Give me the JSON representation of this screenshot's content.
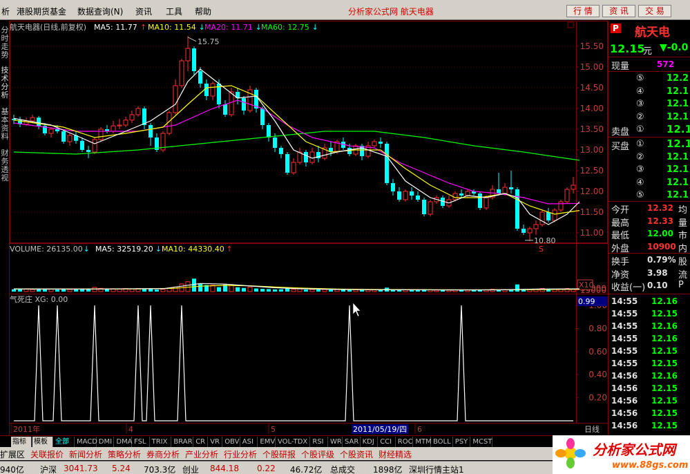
{
  "menu": {
    "items": [
      "析",
      "港股期货基金",
      "数据查询(N)",
      "资讯",
      "工具",
      "帮助"
    ],
    "site": "分析家公式网",
    "stock": "航天电器",
    "buttons": [
      "行 情",
      "资 讯",
      "交 易"
    ]
  },
  "left_tabs": [
    {
      "label": "分时走势"
    },
    {
      "label": "技术分析"
    },
    {
      "label": "基本资料"
    },
    {
      "label": "财务透视"
    }
  ],
  "kline": {
    "header": {
      "title": "航天电器(日线,前复权)",
      "ma5": "MA5: 11.77",
      "ma10": "MA10: 11.54",
      "ma20": "MA20: 11.71",
      "ma60": "MA60: 12.75"
    },
    "ylabels": [
      "15.50",
      "15.00",
      "14.50",
      "14.00",
      "13.50",
      "13.00",
      "12.50",
      "12.00",
      "11.50",
      "11.00"
    ],
    "ylim": [
      10.75,
      15.75
    ],
    "high_label": "15.75",
    "low_label": "10.80",
    "mark_s": "S",
    "candles": [
      [
        13.75,
        13.72,
        13.85,
        13.62
      ],
      [
        13.72,
        13.62,
        13.8,
        13.55
      ],
      [
        13.62,
        13.7,
        13.78,
        13.58
      ],
      [
        13.7,
        13.78,
        13.85,
        13.65
      ],
      [
        13.78,
        13.58,
        13.82,
        13.5
      ],
      [
        13.58,
        13.4,
        13.65,
        13.35
      ],
      [
        13.4,
        13.5,
        13.55,
        13.3
      ],
      [
        13.5,
        13.45,
        13.6,
        13.4
      ],
      [
        13.45,
        13.2,
        13.5,
        13.15
      ],
      [
        13.2,
        13.35,
        13.42,
        13.1
      ],
      [
        13.35,
        13.22,
        13.45,
        13.15
      ],
      [
        13.22,
        13.0,
        13.3,
        12.95
      ],
      [
        13.0,
        12.95,
        13.1,
        12.8
      ],
      [
        12.95,
        13.25,
        13.3,
        12.9
      ],
      [
        13.25,
        13.5,
        13.55,
        13.2
      ],
      [
        13.5,
        13.45,
        13.6,
        13.4
      ],
      [
        13.45,
        13.58,
        13.7,
        13.4
      ],
      [
        13.58,
        13.6,
        13.75,
        13.5
      ],
      [
        13.6,
        13.72,
        13.8,
        13.55
      ],
      [
        13.72,
        13.85,
        13.95,
        13.65
      ],
      [
        13.85,
        14.0,
        14.05,
        13.8
      ],
      [
        14.0,
        13.6,
        14.05,
        13.5
      ],
      [
        13.6,
        13.3,
        13.65,
        13.1
      ],
      [
        13.3,
        13.0,
        13.4,
        12.95
      ],
      [
        13.0,
        13.4,
        13.45,
        12.95
      ],
      [
        13.4,
        13.9,
        13.95,
        13.35
      ],
      [
        13.9,
        14.55,
        14.7,
        13.85
      ],
      [
        14.55,
        15.15,
        15.2,
        14.5
      ],
      [
        15.15,
        15.45,
        15.75,
        14.9
      ],
      [
        15.45,
        14.9,
        15.5,
        14.8
      ],
      [
        14.9,
        14.6,
        15.0,
        14.5
      ],
      [
        14.6,
        14.3,
        14.7,
        14.2
      ],
      [
        14.3,
        14.6,
        14.65,
        14.2
      ],
      [
        14.6,
        14.1,
        14.7,
        14.0
      ],
      [
        14.1,
        13.85,
        14.2,
        13.8
      ],
      [
        13.85,
        14.4,
        14.5,
        13.8
      ],
      [
        14.4,
        14.25,
        14.5,
        14.1
      ],
      [
        14.25,
        13.95,
        14.3,
        13.85
      ],
      [
        13.95,
        14.45,
        14.55,
        13.9
      ],
      [
        14.45,
        14.0,
        14.5,
        13.9
      ],
      [
        14.0,
        13.6,
        14.05,
        13.5
      ],
      [
        13.6,
        13.3,
        13.65,
        13.2
      ],
      [
        13.3,
        13.05,
        13.4,
        12.95
      ],
      [
        13.05,
        12.9,
        13.1,
        12.8
      ],
      [
        12.9,
        12.45,
        12.95,
        12.4
      ],
      [
        12.45,
        12.7,
        12.8,
        12.4
      ],
      [
        12.7,
        12.95,
        13.05,
        12.65
      ],
      [
        12.95,
        12.7,
        13.0,
        12.6
      ],
      [
        12.7,
        12.95,
        13.05,
        12.65
      ],
      [
        12.95,
        12.8,
        13.1,
        12.7
      ],
      [
        12.8,
        13.05,
        13.15,
        12.75
      ],
      [
        13.05,
        12.95,
        13.2,
        12.85
      ],
      [
        12.95,
        13.2,
        13.25,
        12.9
      ],
      [
        13.2,
        13.05,
        13.3,
        13.0
      ],
      [
        13.05,
        12.9,
        13.15,
        12.85
      ],
      [
        12.9,
        13.1,
        13.15,
        12.85
      ],
      [
        13.1,
        12.85,
        13.15,
        12.75
      ],
      [
        12.85,
        13.1,
        13.2,
        12.8
      ],
      [
        13.1,
        13.2,
        13.25,
        13.05
      ],
      [
        13.2,
        13.15,
        13.3,
        13.05
      ],
      [
        13.15,
        12.2,
        13.2,
        12.15
      ],
      [
        12.2,
        12.0,
        12.3,
        11.9
      ],
      [
        12.0,
        11.8,
        12.1,
        11.75
      ],
      [
        11.8,
        12.0,
        12.05,
        11.75
      ],
      [
        12.0,
        11.9,
        12.1,
        11.8
      ],
      [
        11.9,
        11.8,
        12.0,
        11.75
      ],
      [
        11.8,
        11.45,
        11.85,
        11.4
      ],
      [
        11.45,
        11.75,
        11.8,
        11.4
      ],
      [
        11.75,
        11.85,
        11.9,
        11.7
      ],
      [
        11.85,
        11.65,
        11.9,
        11.6
      ],
      [
        11.65,
        11.8,
        11.9,
        11.6
      ],
      [
        11.8,
        11.95,
        12.0,
        11.75
      ],
      [
        11.95,
        11.9,
        12.05,
        11.85
      ],
      [
        11.9,
        12.0,
        12.05,
        11.85
      ],
      [
        12.0,
        11.95,
        12.05,
        11.9
      ],
      [
        11.95,
        11.6,
        12.0,
        11.55
      ],
      [
        11.6,
        11.85,
        11.9,
        11.55
      ],
      [
        11.85,
        12.05,
        12.15,
        11.8
      ],
      [
        12.05,
        11.95,
        12.45,
        11.9
      ],
      [
        11.95,
        12.1,
        12.2,
        11.9
      ],
      [
        12.1,
        12.05,
        12.5,
        11.95
      ],
      [
        12.05,
        11.1,
        12.1,
        11.05
      ],
      [
        11.1,
        11.0,
        11.2,
        10.95
      ],
      [
        11.0,
        11.1,
        11.15,
        10.8
      ],
      [
        11.1,
        11.2,
        11.3,
        10.95
      ],
      [
        11.2,
        11.5,
        11.55,
        11.15
      ],
      [
        11.5,
        11.3,
        11.6,
        11.25
      ],
      [
        11.3,
        11.55,
        11.6,
        11.25
      ],
      [
        11.55,
        11.75,
        11.8,
        11.5
      ],
      [
        11.75,
        12.05,
        12.1,
        11.7
      ],
      [
        12.05,
        12.15,
        12.35,
        11.95
      ]
    ],
    "ma5": [
      [
        0,
        13.76
      ],
      [
        6,
        13.6
      ],
      [
        10,
        13.35
      ],
      [
        13,
        13.15
      ],
      [
        18,
        13.45
      ],
      [
        22,
        13.7
      ],
      [
        26,
        14.1
      ],
      [
        28,
        14.65
      ],
      [
        30,
        14.95
      ],
      [
        33,
        14.6
      ],
      [
        36,
        14.25
      ],
      [
        39,
        14.3
      ],
      [
        42,
        13.7
      ],
      [
        45,
        13.0
      ],
      [
        48,
        12.8
      ],
      [
        52,
        12.95
      ],
      [
        56,
        13.05
      ],
      [
        60,
        12.85
      ],
      [
        63,
        12.25
      ],
      [
        67,
        11.85
      ],
      [
        70,
        11.72
      ],
      [
        73,
        11.9
      ],
      [
        76,
        11.85
      ],
      [
        79,
        11.95
      ],
      [
        81,
        11.85
      ],
      [
        83,
        11.45
      ],
      [
        86,
        11.2
      ],
      [
        89,
        11.45
      ],
      [
        91,
        11.75
      ]
    ],
    "ma10": [
      [
        0,
        13.72
      ],
      [
        8,
        13.55
      ],
      [
        13,
        13.3
      ],
      [
        18,
        13.4
      ],
      [
        24,
        13.55
      ],
      [
        28,
        14.1
      ],
      [
        31,
        14.5
      ],
      [
        35,
        14.55
      ],
      [
        39,
        14.3
      ],
      [
        43,
        13.75
      ],
      [
        47,
        13.2
      ],
      [
        51,
        12.95
      ],
      [
        55,
        13.0
      ],
      [
        59,
        13.0
      ],
      [
        63,
        12.55
      ],
      [
        67,
        12.15
      ],
      [
        71,
        11.85
      ],
      [
        75,
        11.85
      ],
      [
        79,
        11.95
      ],
      [
        83,
        11.65
      ],
      [
        87,
        11.45
      ],
      [
        91,
        11.54
      ]
    ],
    "ma20": [
      [
        0,
        13.65
      ],
      [
        10,
        13.45
      ],
      [
        20,
        13.45
      ],
      [
        26,
        13.6
      ],
      [
        32,
        14.0
      ],
      [
        36,
        14.2
      ],
      [
        40,
        14.0
      ],
      [
        44,
        13.6
      ],
      [
        48,
        13.3
      ],
      [
        54,
        13.1
      ],
      [
        58,
        13.05
      ],
      [
        62,
        12.7
      ],
      [
        66,
        12.45
      ],
      [
        70,
        12.2
      ],
      [
        74,
        12.0
      ],
      [
        78,
        11.95
      ],
      [
        82,
        11.85
      ],
      [
        86,
        11.7
      ],
      [
        91,
        11.71
      ]
    ],
    "ma60": [
      [
        0,
        12.95
      ],
      [
        10,
        12.9
      ],
      [
        20,
        13.0
      ],
      [
        30,
        13.15
      ],
      [
        40,
        13.3
      ],
      [
        50,
        13.45
      ],
      [
        58,
        13.45
      ],
      [
        66,
        13.3
      ],
      [
        74,
        13.1
      ],
      [
        82,
        12.95
      ],
      [
        91,
        12.75
      ]
    ]
  },
  "volume": {
    "header": {
      "vol": "VOLUME: 26135.00",
      "ma5": "MA5: 32519.20",
      "ma10": "MA10: 44330.40"
    },
    "ylabels": [
      "30000",
      "15000"
    ],
    "scale": "X10",
    "ymax": 36000,
    "values": [
      2200,
      2600,
      2400,
      2000,
      2800,
      2200,
      2500,
      1800,
      2600,
      2000,
      2300,
      2500,
      2900,
      4000,
      3100,
      2500,
      2800,
      2500,
      3000,
      2600,
      3000,
      2400,
      2600,
      1900,
      2200,
      3500,
      4400,
      7400,
      9500,
      12500,
      8000,
      6300,
      6200,
      4300,
      6800,
      6000,
      4200,
      3500,
      4300,
      3000,
      2600,
      2400,
      2100,
      2200,
      3100,
      2200,
      2600,
      1800,
      2000,
      1900,
      2100,
      1700,
      2200,
      1800,
      1500,
      1800,
      1500,
      1600,
      1700,
      1600,
      3800,
      1700,
      1400,
      1600,
      1500,
      1300,
      2300,
      1700,
      1400,
      1600,
      1500,
      1700,
      1400,
      1600,
      1500,
      1800,
      1600,
      2200,
      1700,
      1800,
      1600,
      6900,
      2400,
      1900,
      2000,
      3000,
      2200,
      2400,
      2600,
      3000,
      2600
    ],
    "ma5": [
      [
        0,
        2600
      ],
      [
        12,
        2500
      ],
      [
        20,
        2800
      ],
      [
        24,
        2700
      ],
      [
        27,
        5200
      ],
      [
        30,
        7800
      ],
      [
        34,
        7200
      ],
      [
        38,
        5400
      ],
      [
        42,
        3700
      ],
      [
        46,
        2700
      ],
      [
        52,
        2100
      ],
      [
        58,
        1800
      ],
      [
        64,
        1700
      ],
      [
        70,
        1600
      ],
      [
        78,
        1650
      ],
      [
        84,
        2400
      ],
      [
        91,
        2600
      ]
    ],
    "ma10": [
      [
        0,
        2500
      ],
      [
        20,
        2600
      ],
      [
        26,
        3200
      ],
      [
        30,
        5200
      ],
      [
        34,
        6000
      ],
      [
        38,
        5600
      ],
      [
        42,
        4500
      ],
      [
        46,
        3500
      ],
      [
        52,
        2500
      ],
      [
        58,
        2000
      ],
      [
        66,
        1800
      ],
      [
        74,
        1650
      ],
      [
        82,
        1850
      ],
      [
        91,
        2200
      ]
    ]
  },
  "indicator": {
    "header": "气死庄 XG: 0.00",
    "ylabels": [
      "1.00",
      "0.80",
      "0.60",
      "0.40",
      "0.20"
    ],
    "current": "0.99",
    "signals": [
      4,
      7,
      13,
      20,
      22,
      27,
      54,
      72
    ]
  },
  "xaxis": {
    "labels": [
      "2011年",
      "4",
      "5",
      "6"
    ],
    "date_box": "2011/05/19/四",
    "period": "日线"
  },
  "quote": {
    "badge": "P",
    "name": "航天电",
    "price": "12.15",
    "price_unit": "元",
    "change": "▼-0.0",
    "rows": [
      {
        "l": "现量",
        "v": "572",
        "vc": "#ff00ff",
        "s": ""
      }
    ],
    "asks": [
      [
        "⑤",
        "12.2"
      ],
      [
        "④",
        "12.1"
      ],
      [
        "③",
        "12.1"
      ],
      [
        "②",
        "12.1"
      ],
      [
        "卖盘①",
        "12.1"
      ]
    ],
    "bids": [
      [
        "买盘①",
        "12.1"
      ],
      [
        "②",
        "12.1"
      ],
      [
        "③",
        "12.1"
      ],
      [
        "④",
        "12.1"
      ],
      [
        "⑤",
        "12.1"
      ]
    ],
    "stats": [
      [
        "今开",
        "12.32",
        "#ff3030",
        "均"
      ],
      [
        "最高",
        "12.33",
        "#ff3030",
        "量"
      ],
      [
        "最低",
        "12.00",
        "#00ff00",
        "市"
      ],
      [
        "外盘",
        "10900",
        "#ff3030",
        "内"
      ],
      [
        "换手",
        "0.79%",
        "#e0e0e0",
        "股"
      ],
      [
        "净资",
        "3.98",
        "#e0e0e0",
        "流"
      ],
      [
        "收益(一)",
        "0.10",
        "#e0e0e0",
        "P"
      ]
    ],
    "ticks": [
      [
        "14:55",
        "12.16"
      ],
      [
        "14:55",
        "12.15"
      ],
      [
        "14:55",
        "12.16"
      ],
      [
        "14:55",
        "12.16"
      ],
      [
        "14:55",
        "12.15"
      ],
      [
        "14:55",
        "12.15"
      ],
      [
        "14:56",
        "12.16"
      ],
      [
        "14:56",
        "12.15"
      ],
      [
        "14:56",
        "12.15"
      ],
      [
        "14:56",
        "12.15"
      ],
      [
        "14:56",
        "12.15"
      ]
    ]
  },
  "indicator_tabs": [
    "指标",
    "模板",
    "全部",
    "MACD",
    "DMI",
    "DMA",
    "FSL",
    "TRIX",
    "BRAR",
    "CR",
    "VR",
    "OBV",
    "ASI",
    "EMV",
    "VOL-TDX",
    "RSI",
    "WR",
    "SAR",
    "KDJ",
    "CCI",
    "ROC",
    "MTM",
    "BOLL",
    "PSY",
    "MCST"
  ],
  "sub_tabs": [
    "扩展区",
    "关联报价",
    "新闻分析",
    "策略分析",
    "券商分析",
    "产业分析",
    "行业分析",
    "个股研报",
    "个股评级",
    "个股资讯",
    "财经精选"
  ],
  "status": [
    {
      "t": "940亿",
      "c": "#000"
    },
    {
      "t": "沪深",
      "c": "#000"
    },
    {
      "t": "3041.73",
      "c": "#c00000"
    },
    {
      "t": "5.24",
      "c": "#c00000"
    },
    {
      "t": "703.3亿",
      "c": "#000"
    },
    {
      "t": "创业",
      "c": "#000"
    },
    {
      "t": "844.18",
      "c": "#c00000"
    },
    {
      "t": "0.22",
      "c": "#c00000"
    },
    {
      "t": "46.72亿",
      "c": "#000"
    },
    {
      "t": "总成交",
      "c": "#000"
    },
    {
      "t": "1898亿",
      "c": "#000"
    },
    {
      "t": "深圳行情主站1",
      "c": "#000"
    }
  ],
  "logo": {
    "title": "分析家公式网",
    "url": "www.88gs.com"
  },
  "colors": {
    "up": "#ff3030",
    "down": "#00ffff",
    "ma5": "#ffffff",
    "ma10": "#ffff00",
    "ma20": "#ff00ff",
    "ma60": "#00ff00",
    "grid": "#800000"
  }
}
